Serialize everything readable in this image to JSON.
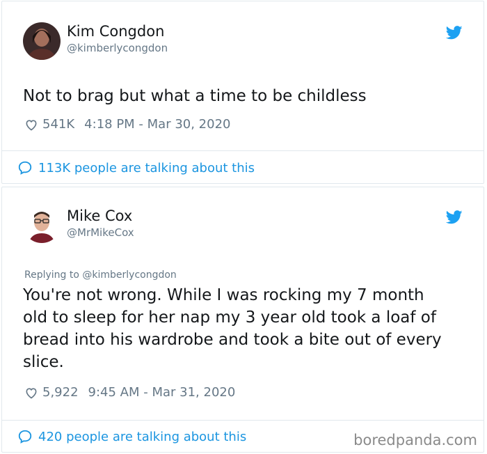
{
  "brand_colors": {
    "twitter_blue": "#1da1f2",
    "link_blue": "#1b95e0",
    "gray": "#657786"
  },
  "tweets": [
    {
      "author_name": "Kim Congdon",
      "author_handle": "@kimberlycongdon",
      "text": "Not to brag but what a time to be childless",
      "likes": "541K",
      "timestamp": "4:18 PM - Mar 30, 2020",
      "talking": "113K people are talking about this",
      "icons": [
        "heart-icon",
        "twitter-bird-icon",
        "speech-bubble-icon"
      ]
    },
    {
      "author_name": "Mike Cox",
      "author_handle": "@MrMikeCox",
      "replying_to": "Replying to @kimberlycongdon",
      "text_lines": [
        "You're not wrong. While I was rocking my 7 month",
        "old to sleep for her nap my 3 year  old took a loaf of",
        "bread into his wardrobe and took a bite out of every",
        "slice."
      ],
      "likes": "5,922",
      "timestamp": "9:45 AM - Mar 31, 2020",
      "talking": "420 people are talking about this",
      "icons": [
        "heart-icon",
        "twitter-bird-icon",
        "speech-bubble-icon"
      ]
    }
  ],
  "watermark": "boredpanda.com"
}
